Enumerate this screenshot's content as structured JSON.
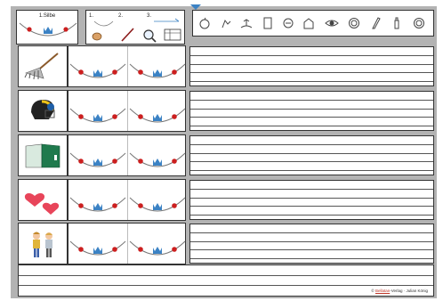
{
  "header": {
    "syllable_label": "1.Silbe",
    "steps": [
      "1.",
      "2.",
      "3."
    ]
  },
  "icons": [
    "apple-icon",
    "hand-pointing-icon",
    "island-icon",
    "book-icon",
    "clock-icon",
    "house-icon",
    "eye-icon",
    "coin-icon",
    "pencil-icon",
    "bottle-icon",
    "money-icon"
  ],
  "rows": [
    {
      "picture": "rake-icon"
    },
    {
      "picture": "football-helmet-icon"
    },
    {
      "picture": "folder-icon"
    },
    {
      "picture": "hearts-icon"
    },
    {
      "picture": "children-icon"
    }
  ],
  "footer": {
    "credit_prefix": "© ",
    "credit_brand": "Bellatan",
    "credit_suffix": "-Verlag · Julian König"
  },
  "colors": {
    "dot": "#cc1f1f",
    "crown": "#3b82c4",
    "background": "#b3b3b3"
  }
}
